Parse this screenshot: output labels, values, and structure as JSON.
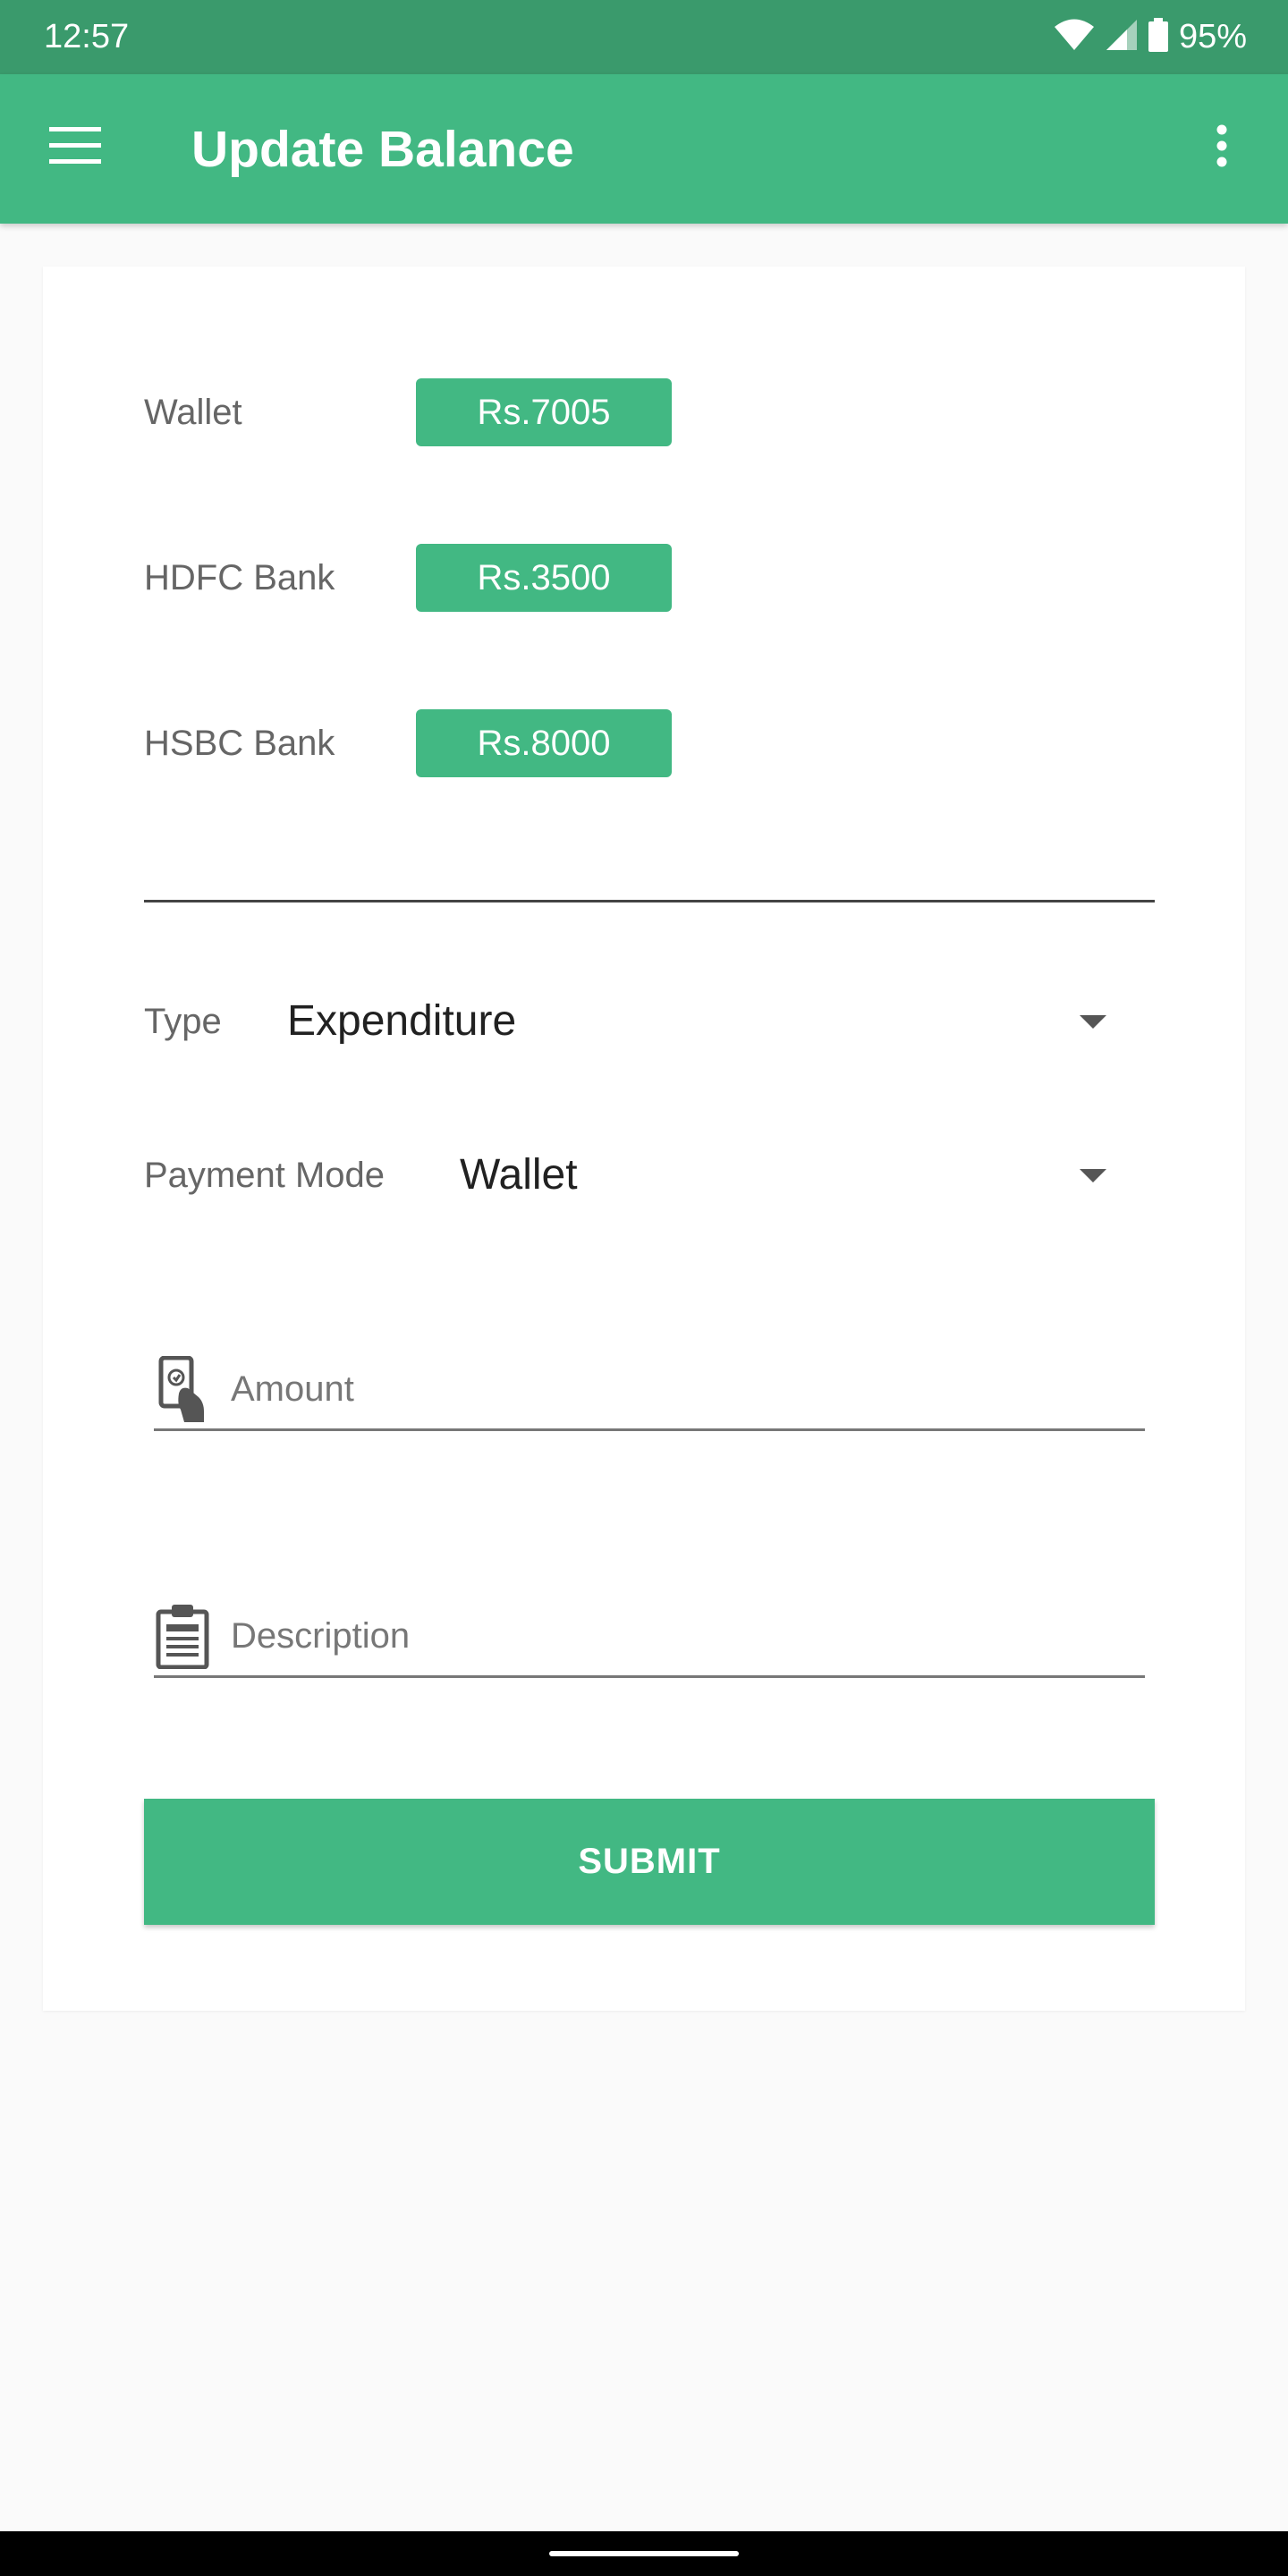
{
  "status_bar": {
    "time": "12:57",
    "battery": "95%"
  },
  "app_bar": {
    "title": "Update Balance"
  },
  "balances": [
    {
      "label": "Wallet",
      "amount": "Rs.7005"
    },
    {
      "label": "HDFC Bank",
      "amount": "Rs.3500"
    },
    {
      "label": "HSBC Bank",
      "amount": "Rs.8000"
    }
  ],
  "form": {
    "type_label": "Type",
    "type_value": "Expenditure",
    "payment_mode_label": "Payment Mode",
    "payment_mode_value": "Wallet",
    "amount_placeholder": "Amount",
    "description_placeholder": "Description",
    "submit_label": "SUBMIT"
  },
  "colors": {
    "status_bar": "#3a9a6c",
    "primary": "#42b883",
    "background": "#fafafa"
  },
  "icons": {
    "menu": "menu-icon",
    "more": "more-vert-icon",
    "wifi": "wifi-icon",
    "signal": "cell-signal-icon",
    "battery": "battery-icon",
    "amount": "cash-hand-icon",
    "description": "clipboard-icon",
    "dropdown": "arrow-drop-down-icon"
  }
}
